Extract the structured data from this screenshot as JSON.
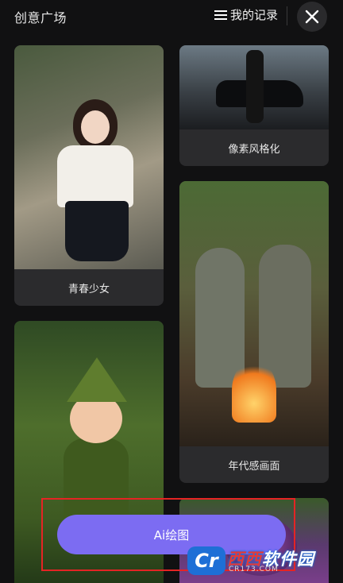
{
  "header": {
    "title": "创意广场",
    "records_label": "我的记录"
  },
  "gallery": {
    "cards": [
      {
        "label": "青春少女"
      },
      {
        "label": "像素风格化"
      },
      {
        "label": "年代感画面"
      }
    ]
  },
  "action": {
    "ai_draw_label": "Ai绘图"
  },
  "watermark": {
    "logo_text": "Cr",
    "name_part1": "西西",
    "name_part2": "软件园",
    "url": "CR173.COM"
  },
  "colors": {
    "background": "#111112",
    "card": "#2b2b2d",
    "accent_button": "#7c6cf2",
    "highlight_border": "#e52424"
  }
}
